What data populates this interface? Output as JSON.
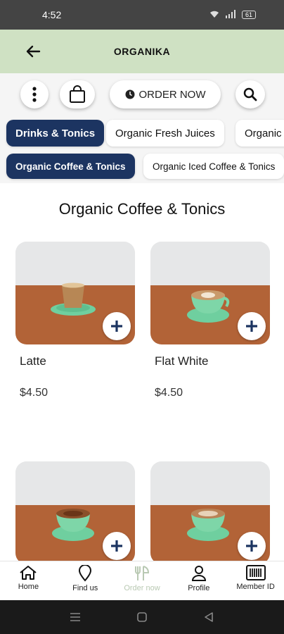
{
  "status_bar": {
    "time": "4:52",
    "battery": "61"
  },
  "app_bar": {
    "title": "ORGANIKA"
  },
  "toolbar": {
    "order_label": "ORDER NOW"
  },
  "category_tabs": [
    {
      "label": "Drinks & Tonics",
      "active": true
    },
    {
      "label": "Organic Fresh Juices",
      "active": false
    },
    {
      "label": "Organic",
      "active": false
    }
  ],
  "sub_tabs": [
    {
      "label": "Organic Coffee & Tonics",
      "active": true
    },
    {
      "label": "Organic Iced Coffee & Tonics",
      "active": false
    }
  ],
  "section": {
    "title": "Organic Coffee & Tonics"
  },
  "products": [
    {
      "name": "Latte",
      "price": "$4.50"
    },
    {
      "name": "Flat White",
      "price": "$4.50"
    },
    {
      "name": "",
      "price": ""
    },
    {
      "name": "",
      "price": ""
    }
  ],
  "bottom_nav": [
    {
      "label": "Home",
      "icon": "home-icon"
    },
    {
      "label": "Find us",
      "icon": "location-pin-icon"
    },
    {
      "label": "Order now",
      "icon": "cutlery-icon"
    },
    {
      "label": "Profile",
      "icon": "user-icon"
    },
    {
      "label": "Member ID",
      "icon": "barcode-icon"
    }
  ],
  "colors": {
    "app_bar": "#cfe1c3",
    "active_tab": "#1c3461",
    "accent_dim": "#b9c9b3",
    "table_wood": "#b26337",
    "saucer": "#6fcf9f"
  }
}
